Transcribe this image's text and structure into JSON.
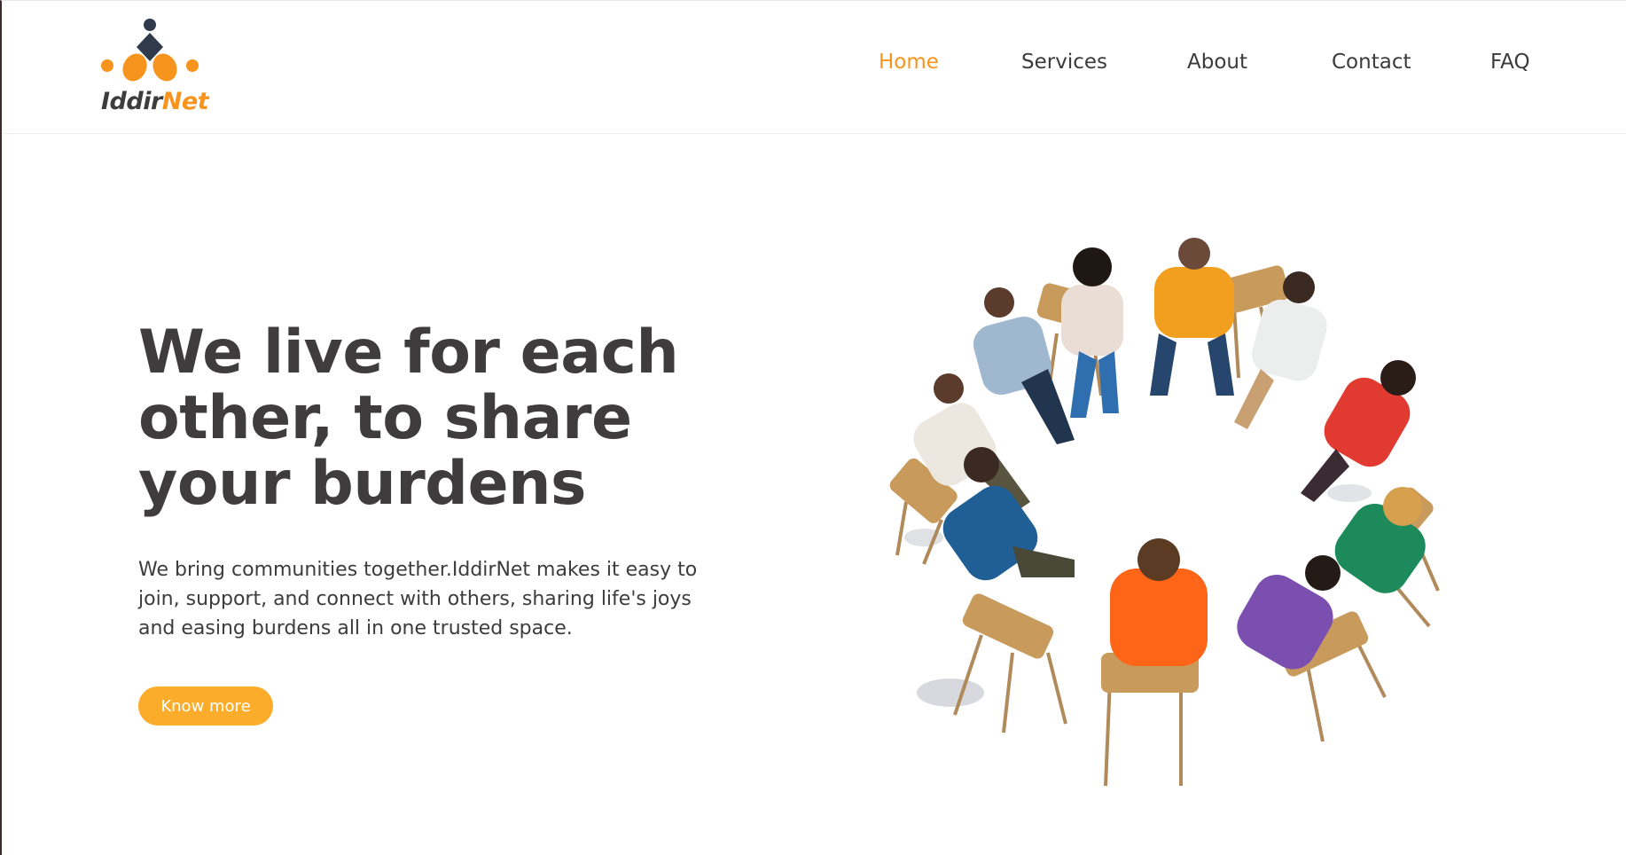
{
  "brand": {
    "name_part1": "Iddir",
    "name_part2": "Net",
    "colors": {
      "accent": "#f7941d",
      "dark": "#2f3a4a",
      "text": "#3e3c3c",
      "button": "#fbac2a"
    }
  },
  "nav": {
    "items": [
      {
        "label": "Home",
        "active": true
      },
      {
        "label": "Services",
        "active": false
      },
      {
        "label": "About",
        "active": false
      },
      {
        "label": "Contact",
        "active": false
      },
      {
        "label": "FAQ",
        "active": false
      }
    ]
  },
  "hero": {
    "title": "We live for each other, to share your burdens",
    "description": "We bring communities together.IddirNet makes it easy to join, support, and connect with others, sharing life's joys and easing burdens all in one trusted space.",
    "button_label": "Know more"
  },
  "illustration": {
    "icon": "people-circle-illustration",
    "people_colors": [
      "#f29e1f",
      "#e9e4dc",
      "#3a6fa3",
      "#eeeeee",
      "#1f6fa8",
      "#ff6a1a",
      "#7a4fb0",
      "#1c8a5a",
      "#e33b33",
      "#e8e8e8",
      "#c95a8a"
    ]
  }
}
